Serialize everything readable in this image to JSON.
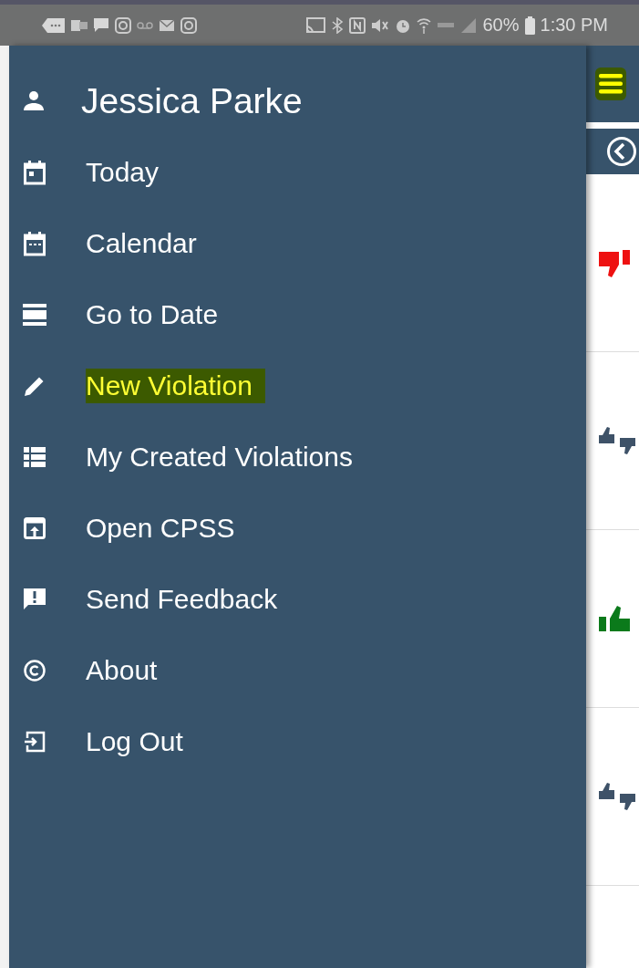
{
  "status_bar": {
    "battery": "60%",
    "time": "1:30 PM"
  },
  "drawer": {
    "user_name": "Jessica Parke",
    "items": [
      {
        "kind": "today",
        "label": "Today",
        "highlighted": false
      },
      {
        "kind": "calendar",
        "label": "Calendar",
        "highlighted": false
      },
      {
        "kind": "goto",
        "label": "Go to Date",
        "highlighted": false
      },
      {
        "kind": "new",
        "label": "New Violation",
        "highlighted": true
      },
      {
        "kind": "list",
        "label": "My Created Violations",
        "highlighted": false
      },
      {
        "kind": "open",
        "label": "Open CPSS",
        "highlighted": false
      },
      {
        "kind": "feedback",
        "label": "Send Feedback",
        "highlighted": false
      },
      {
        "kind": "about",
        "label": "About",
        "highlighted": false
      },
      {
        "kind": "logout",
        "label": "Log Out",
        "highlighted": false
      }
    ]
  },
  "background_page": {
    "menu_button": {
      "highlighted": true
    },
    "rows": [
      {
        "kind": "down"
      },
      {
        "kind": "neutral"
      },
      {
        "kind": "up"
      },
      {
        "kind": "neutral"
      }
    ]
  }
}
